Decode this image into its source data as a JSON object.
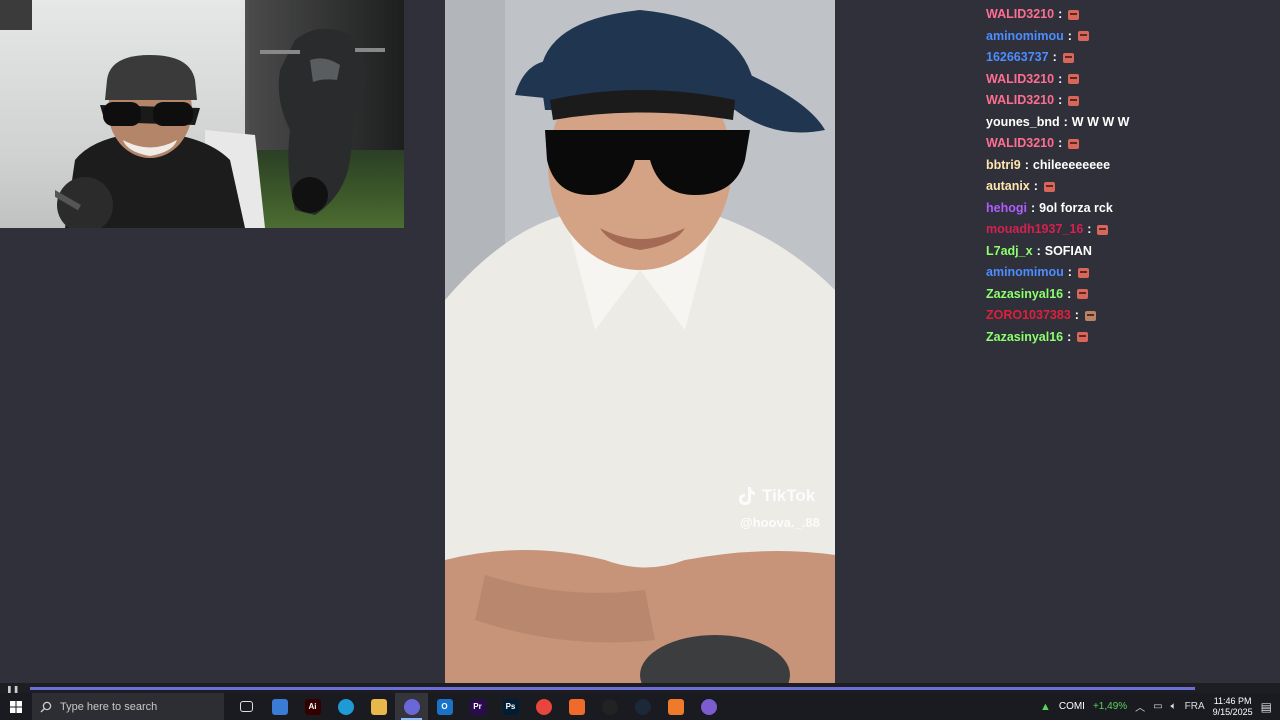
{
  "colors": {
    "background": "#2f3039",
    "taskbar": "#1a1b20",
    "progress_accent": "#6d6fd8"
  },
  "video_overlay": {
    "brand": "TikTok",
    "handle": "@hoova._.88"
  },
  "progress": {
    "fraction": 0.955
  },
  "chat": {
    "messages": [
      {
        "user": "WALID3210",
        "color": "#ff6e91",
        "message": "",
        "emote": "face-emote"
      },
      {
        "user": "aminomimou",
        "color": "#4d8dff",
        "message": "",
        "emote": "face-emote"
      },
      {
        "user": "162663737",
        "color": "#4d8dff",
        "message": "",
        "emote": "face-emote"
      },
      {
        "user": "WALID3210",
        "color": "#ff6e91",
        "message": "",
        "emote": "face-emote"
      },
      {
        "user": "WALID3210",
        "color": "#ff6e91",
        "message": "",
        "emote": "face-emote"
      },
      {
        "user": "younes_bnd",
        "color": "#ffffff",
        "message": "W W W W",
        "emote": ""
      },
      {
        "user": "WALID3210",
        "color": "#ff6e91",
        "message": "",
        "emote": "face-emote"
      },
      {
        "user": "bbtri9",
        "color": "#ffe6b0",
        "message": "chileeeeeeee",
        "emote": ""
      },
      {
        "user": "autanix",
        "color": "#ffe6b0",
        "message": "",
        "emote": "face-emote"
      },
      {
        "user": "hehogi",
        "color": "#b05cff",
        "message": "9ol forza rck",
        "emote": ""
      },
      {
        "user": "mouadh1937_16",
        "color": "#d6204f",
        "message": "",
        "emote": "face-emote"
      },
      {
        "user": "L7adj_x",
        "color": "#8cff6e",
        "message": "SOFIAN",
        "emote": ""
      },
      {
        "user": "aminomimou",
        "color": "#4d8dff",
        "message": "",
        "emote": "face-emote"
      },
      {
        "user": "Zazasinyal16",
        "color": "#8cff6e",
        "message": "",
        "emote": "face-emote"
      },
      {
        "user": "ZORO1037383",
        "color": "#e0203a",
        "message": "",
        "emote": "face-emote-brown"
      },
      {
        "user": "Zazasinyal16",
        "color": "#8cff6e",
        "message": "",
        "emote": "face-emote"
      }
    ]
  },
  "taskbar": {
    "search_placeholder": "Type here to search",
    "apps": [
      {
        "name": "task-view-icon",
        "glyph": "",
        "color": "#1a1b20"
      },
      {
        "name": "store-icon",
        "glyph": "",
        "color": "#3a7bd5"
      },
      {
        "name": "illustrator-icon",
        "glyph": "Ai",
        "color": "#330000"
      },
      {
        "name": "edge-icon",
        "glyph": "",
        "color": "#1e9ad6"
      },
      {
        "name": "file-explorer-icon",
        "glyph": "",
        "color": "#e8b84a"
      },
      {
        "name": "streamlabs-icon",
        "glyph": "",
        "color": "#6a67d8",
        "active": true
      },
      {
        "name": "outlook-icon",
        "glyph": "O",
        "color": "#1a73c9"
      },
      {
        "name": "premiere-icon",
        "glyph": "Pr",
        "color": "#2a0c4e"
      },
      {
        "name": "photoshop-icon",
        "glyph": "Ps",
        "color": "#001d34"
      },
      {
        "name": "chrome-icon",
        "glyph": "",
        "color": "#e8453c"
      },
      {
        "name": "brave-icon",
        "glyph": "",
        "color": "#f06a2b"
      },
      {
        "name": "obs-icon",
        "glyph": "",
        "color": "#222"
      },
      {
        "name": "steam-icon",
        "glyph": "",
        "color": "#1b2838"
      },
      {
        "name": "aximp-icon",
        "glyph": "",
        "color": "#ee7a2a"
      },
      {
        "name": "twitch-chat-icon",
        "glyph": "",
        "color": "#7c5cd1"
      }
    ],
    "stock": {
      "name": "COMI",
      "change": "+1,49%"
    },
    "language": "FRA",
    "time": "11:46 PM",
    "date": "9/15/2025"
  }
}
